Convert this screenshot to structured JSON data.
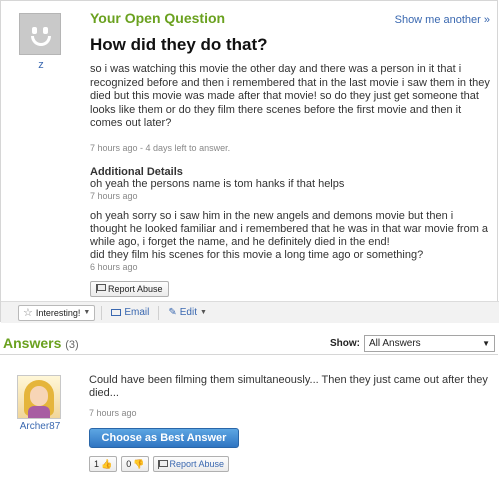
{
  "question": {
    "kicker": "Your Open Question",
    "show_another": "Show me another »",
    "title": "How did they do that?",
    "asker": "z",
    "body": "so i was watching this movie the other day and there was a person in it that i recognized before and then i remembered that in the last movie i saw them in they died but this movie was made after that movie! so do they just get someone that looks like them or do they film there scenes before the first movie and then it comes out later?",
    "meta": "7 hours ago - 4 days left to answer.",
    "additional_details_heading": "Additional Details",
    "details": [
      {
        "text": "oh yeah the persons name is tom hanks if that helps",
        "meta": "7 hours ago"
      },
      {
        "text": "oh yeah sorry so i saw him in the new angels and demons movie but then i thought he looked familiar and i remembered that he was in that war movie from a while ago, i forget the name, and he definitely died in the end!\ndid they film his scenes for this movie a long time ago or something?",
        "meta": "6 hours ago"
      }
    ],
    "report_label": "Report Abuse"
  },
  "toolbar": {
    "interesting_label": "Interesting!",
    "email_label": "Email",
    "edit_label": "Edit"
  },
  "answers": {
    "title": "Answers",
    "count": "(3)",
    "show_label": "Show:",
    "show_value": "All Answers"
  },
  "answer1": {
    "user": "Archer87",
    "body": "Could have been filming them simultaneously... Then they just came out after they died...",
    "meta": "7 hours ago",
    "best_label": "Choose as Best Answer",
    "thumbs_up": "1",
    "thumbs_down": "0",
    "report_label": "Report Abuse"
  }
}
